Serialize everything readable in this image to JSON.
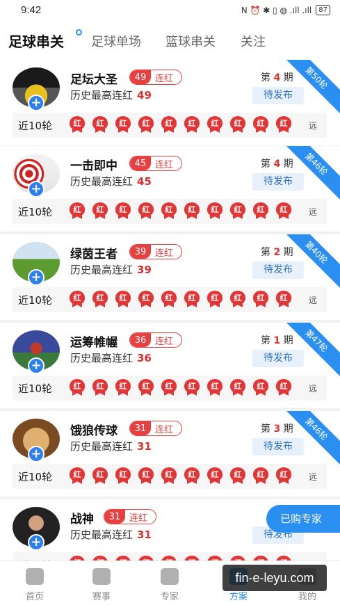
{
  "status_bar": {
    "time": "9:42",
    "icons": "N ⏰ ✱ ▯ ◍ .ıll .ıll",
    "battery": "87"
  },
  "top_tabs": [
    "足球串关",
    "足球单场",
    "篮球串关",
    "关注"
  ],
  "recent_label": "近10轮",
  "recent_far": "远",
  "hong_char": "红",
  "streak_suffix": "连红",
  "history_prefix": "历史最高连红",
  "period_prefix": "第",
  "period_suffix": "期",
  "pending_label": "待发布",
  "experts": [
    {
      "name": "足坛大圣",
      "streak": "49",
      "history": "49",
      "period": "4",
      "ribbon": "第50轮",
      "avatar": "car"
    },
    {
      "name": "一击即中",
      "streak": "45",
      "history": "45",
      "period": "4",
      "ribbon": "第46轮",
      "avatar": "target"
    },
    {
      "name": "绿茵王者",
      "streak": "39",
      "history": "39",
      "period": "2",
      "ribbon": "第40轮",
      "avatar": "field"
    },
    {
      "name": "运筹帷幄",
      "streak": "36",
      "history": "36",
      "period": "1",
      "ribbon": "第47轮",
      "avatar": "player"
    },
    {
      "name": "饿狼传球",
      "streak": "31",
      "history": "31",
      "period": "3",
      "ribbon": "第46轮",
      "avatar": "monkey"
    },
    {
      "name": "战神",
      "streak": "31",
      "history": "31",
      "period": "",
      "ribbon": "",
      "avatar": "man"
    }
  ],
  "bought_button": "已购专家",
  "bottom_nav": [
    "首页",
    "赛事",
    "专家",
    "方案",
    "我的"
  ],
  "watermark": "fin-e-leyu.com",
  "colors": {
    "accent": "#2a8ff0",
    "red": "#e23636"
  }
}
